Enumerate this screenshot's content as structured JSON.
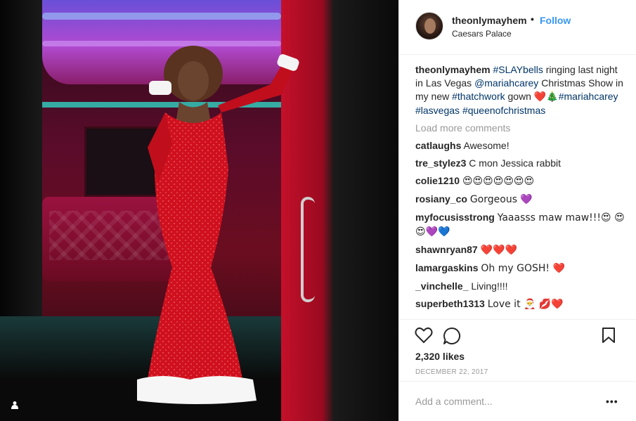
{
  "post": {
    "author": "theonlymayhem",
    "separator": "•",
    "follow_label": "Follow",
    "location": "Caesars Palace"
  },
  "caption": {
    "user": "theonlymayhem",
    "part1": "#SLAYbells",
    "part2": " ringing last night in Las Vegas ",
    "part3": "@mariahcarey",
    "part4": " Christmas Show in my new ",
    "part5": "#thatchwork",
    "part6": " gown ",
    "emoji": "❤️🎄",
    "part7": "#mariahcarey",
    "part8": " ",
    "part9": "#lasvegas",
    "part10": "#queenofchristmas"
  },
  "load_more": "Load more comments",
  "comments": [
    {
      "user": "catlaughs",
      "text": "Awesome!"
    },
    {
      "user": "tre_stylez3",
      "text": "C mon Jessica rabbit"
    },
    {
      "user": "colie1210",
      "text": "😍😍😍😍😍😍😍"
    },
    {
      "user": "rosiany_co",
      "text": "Gorgeous 💜"
    },
    {
      "user": "myfocusisstrong",
      "text": "Yaaasss maw maw!!!😍 😍😍💜💙"
    },
    {
      "user": "shawnryan87",
      "text": "❤️❤️❤️"
    },
    {
      "user": "lamargaskins",
      "text": "Oh my GOSH! ❤️"
    },
    {
      "user": "_vinchelle_",
      "text": "Living!!!!"
    },
    {
      "user": "superbeth1313",
      "text": "Love it 🎅 💋❤️"
    }
  ],
  "likes": "2,320 likes",
  "date": "DECEMBER 22, 2017",
  "add_comment_placeholder": "Add a comment...",
  "more_label": "•••",
  "icons": {
    "like": "heart-outline-icon",
    "comment": "speech-bubble-icon",
    "save": "bookmark-icon",
    "user_tag": "person-icon"
  },
  "colors": {
    "link": "#3897f0",
    "hashtag": "#003569",
    "muted": "#999999",
    "text": "#262626"
  }
}
